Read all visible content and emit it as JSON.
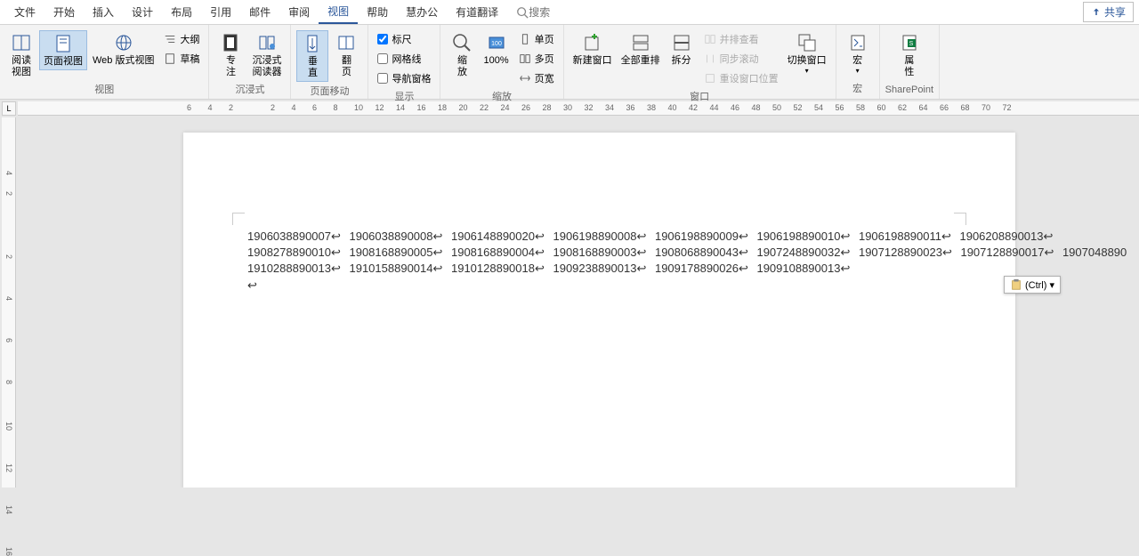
{
  "menu": {
    "items": [
      "文件",
      "开始",
      "插入",
      "设计",
      "布局",
      "引用",
      "邮件",
      "审阅",
      "视图",
      "帮助",
      "慧办公",
      "有道翻译"
    ],
    "active_index": 8,
    "search_placeholder": "搜索",
    "share": "共享"
  },
  "ribbon": {
    "views": {
      "label": "视图",
      "read": "阅读\n视图",
      "print": "页面视图",
      "web": "Web 版式视图",
      "outline": "大纲",
      "draft": "草稿"
    },
    "immersive": {
      "label": "沉浸式",
      "focus": "专\n注",
      "reader": "沉浸式\n阅读器"
    },
    "page_move": {
      "label": "页面移动",
      "vertical": "垂\n直",
      "flip": "翻\n页"
    },
    "show": {
      "label": "显示",
      "ruler": "标尺",
      "gridlines": "网格线",
      "nav": "导航窗格",
      "ruler_checked": true
    },
    "zoom": {
      "label": "缩放",
      "zoom": "缩\n放",
      "hundred": "100%",
      "single": "单页",
      "multi": "多页",
      "width": "页宽"
    },
    "window": {
      "label": "窗口",
      "new": "新建窗口",
      "arrange": "全部重排",
      "split": "拆分",
      "side": "并排查看",
      "sync": "同步滚动",
      "reset": "重设窗口位置",
      "switch": "切换窗口"
    },
    "macros": {
      "label": "宏",
      "btn": "宏"
    },
    "sharepoint": {
      "label": "SharePoint",
      "btn": "属\n性"
    }
  },
  "ruler_corner": "L",
  "h_ticks": [
    6,
    4,
    2,
    "",
    2,
    4,
    6,
    8,
    10,
    12,
    14,
    16,
    18,
    20,
    22,
    24,
    26,
    28,
    30,
    32,
    34,
    36,
    38,
    40,
    42,
    44,
    46,
    48,
    50,
    52,
    54,
    56,
    58,
    60,
    62,
    64,
    66,
    68,
    70,
    72
  ],
  "v_ticks": [
    "",
    "4",
    2,
    "",
    "",
    "2",
    "",
    "4",
    "",
    "6",
    "",
    "8",
    "",
    "10",
    "",
    "12",
    "",
    "14",
    "",
    "16"
  ],
  "document": {
    "lines": [
      "1906038890007↩  1906038890008↩  1906148890020↩  1906198890008↩  1906198890009↩  1906198890010↩  1906198890011↩  1906208890013↩",
      "1908278890010↩  1908168890005↩  1908168890004↩  1908168890003↩  1908068890043↩  1907248890032↩  1907128890023↩  1907128890017↩          1907048890",
      "1910288890013↩  1910158890014↩  1910128890018↩  1909238890013↩  1909178890026↩  1909108890013↩"
    ],
    "cursor": "↩"
  },
  "paste_opts": "(Ctrl) ▾"
}
